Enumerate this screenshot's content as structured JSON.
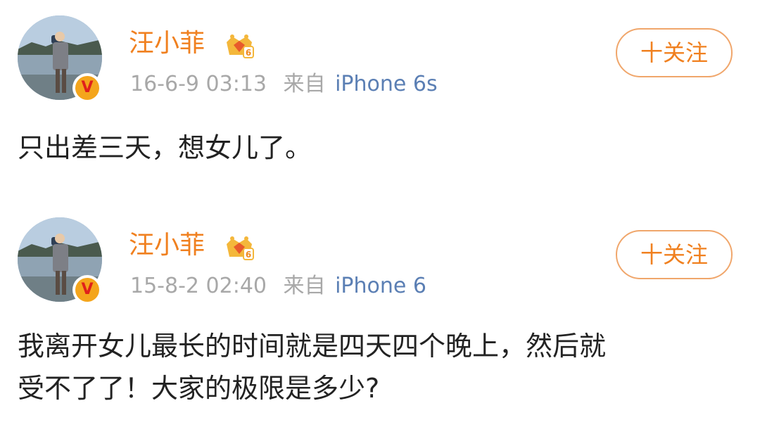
{
  "posts": [
    {
      "username": "汪小菲",
      "timestamp": "16-6-9 03:13",
      "source_prefix": "来自",
      "device": "iPhone 6s",
      "follow_label": "十关注",
      "verified_badge": "V",
      "member_level_icon": "vip-crown-icon",
      "content_lines": [
        "只出差三天，想女儿了。"
      ]
    },
    {
      "username": "汪小菲",
      "timestamp": "15-8-2 02:40",
      "source_prefix": "来自",
      "device": "iPhone 6",
      "follow_label": "十关注",
      "verified_badge": "V",
      "member_level_icon": "vip-crown-icon",
      "content_lines": [
        "我离开女儿最长的时间就是四天四个晚上，然后就",
        "受不了了！大家的极限是多少?"
      ]
    }
  ],
  "colors": {
    "username": "#f0801f",
    "meta": "#a8a8a8",
    "device_link": "#5b7fb4",
    "follow_border": "#f0a66b",
    "verified_bg": "#f4a51c",
    "verified_fg": "#e0201b"
  }
}
